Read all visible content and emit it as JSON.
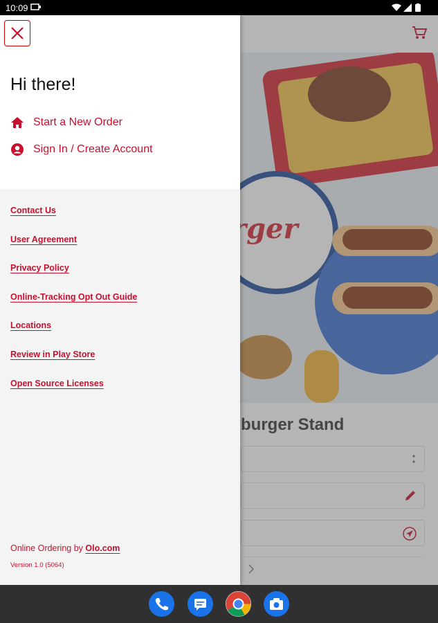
{
  "status_bar": {
    "time": "10:09"
  },
  "background": {
    "store_title": "burger Stand",
    "hero_logo_text": "rger"
  },
  "drawer": {
    "close_label": "Close menu",
    "greeting": "Hi there!",
    "nav": [
      {
        "label": "Start a New Order",
        "icon": "home-icon"
      },
      {
        "label": "Sign In / Create Account",
        "icon": "account-circle-icon"
      }
    ],
    "links": [
      "Contact Us",
      "User Agreement",
      "Privacy Policy",
      "Online-Tracking Opt Out Guide",
      "Locations",
      "Review in Play Store",
      "Open Source Licenses"
    ],
    "footer": {
      "prefix": "Online Ordering by ",
      "link": "Olo.com",
      "version": "Version 1.0 (5064)"
    }
  },
  "colors": {
    "accent": "#c8102e",
    "drawer_bg": "#f4f4f4",
    "navbar": "#303030"
  },
  "dock": [
    "phone-icon",
    "messages-icon",
    "chrome-icon",
    "camera-icon"
  ]
}
